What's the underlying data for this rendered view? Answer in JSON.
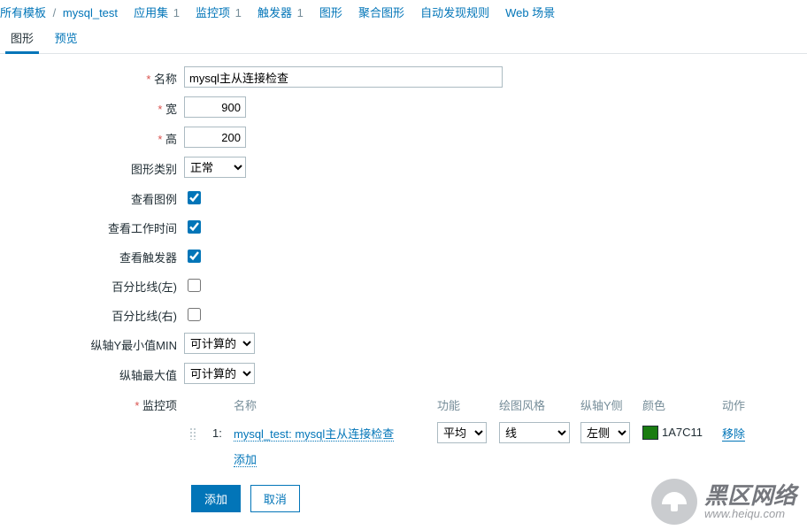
{
  "breadcrumbs": {
    "all_templates": "所有模板",
    "template_name": "mysql_test",
    "apps": "应用集",
    "apps_cnt": "1",
    "items": "监控项",
    "items_cnt": "1",
    "triggers": "触发器",
    "triggers_cnt": "1",
    "graphs": "图形",
    "aggregate": "聚合图形",
    "discovery": "自动发现规则",
    "web": "Web 场景"
  },
  "tabs": {
    "graph": "图形",
    "preview": "预览"
  },
  "labels": {
    "name": "名称",
    "width": "宽",
    "height": "高",
    "type": "图形类别",
    "legend": "查看图例",
    "work": "查看工作时间",
    "trig": "查看触发器",
    "pct_left": "百分比线(左)",
    "pct_right": "百分比线(右)",
    "ymin": "纵轴Y最小值MIN",
    "ymax": "纵轴最大值",
    "items": "监控项"
  },
  "values": {
    "name": "mysql主从连接检查",
    "width": "900",
    "height": "200",
    "type": "正常",
    "ymin": "可计算的",
    "ymax": "可计算的"
  },
  "item_table": {
    "h_name": "名称",
    "h_func": "功能",
    "h_style": "绘图风格",
    "h_yside": "纵轴Y侧",
    "h_color": "颜色",
    "h_action": "动作",
    "rows": [
      {
        "idx": "1:",
        "name": "mysql_test: mysql主从连接检查",
        "func": "平均",
        "style": "线",
        "yside": "左侧",
        "color": "1A7C11",
        "remove": "移除"
      }
    ],
    "add": "添加"
  },
  "buttons": {
    "add": "添加",
    "cancel": "取消"
  },
  "watermark": {
    "zh": "黑区网络",
    "en": "www.heiqu.com"
  }
}
